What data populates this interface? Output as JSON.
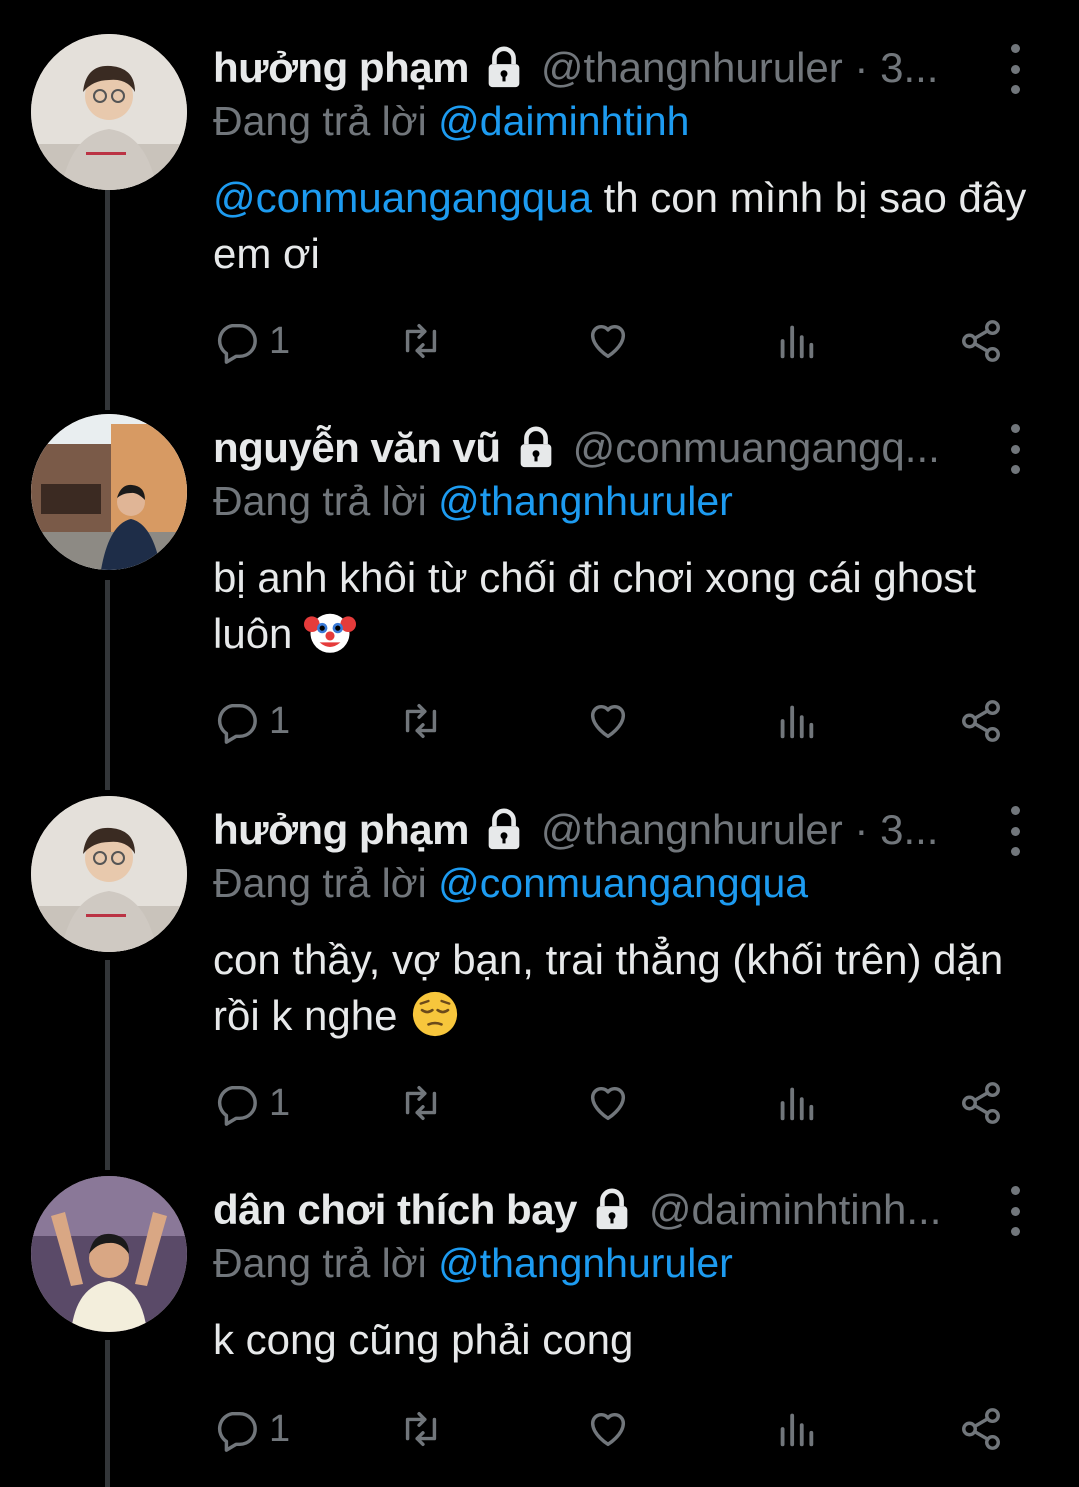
{
  "tweets": [
    {
      "name": "hưởng phạm",
      "handle": "@thangnhuruler · 3...",
      "replying_label": "Đang trả lời",
      "replying_to": "@daiminhtinh",
      "mention": "@conmuangangqua",
      "text": " th con mình bị sao đây em ơi",
      "reply_count": "1"
    },
    {
      "name": "nguyễn văn vũ",
      "handle": "@conmuangangq...",
      "replying_label": "Đang trả lời",
      "replying_to": "@thangnhuruler",
      "mention": "",
      "text": "bị anh khôi từ chối đi chơi xong cái ghost luôn",
      "emoji": "clown-face",
      "reply_count": "1"
    },
    {
      "name": "hưởng phạm",
      "handle": "@thangnhuruler · 3...",
      "replying_label": "Đang trả lời",
      "replying_to": "@conmuangangqua",
      "mention": "",
      "text": "con thầy, vợ bạn, trai thẳng (khối trên) dặn rồi k nghe",
      "emoji": "pensive-face",
      "reply_count": "1"
    },
    {
      "name": "dân chơi thích bay",
      "handle": "@daiminhtinh...",
      "replying_label": "Đang trả lời",
      "replying_to": "@thangnhuruler",
      "mention": "",
      "text": "k cong cũng phải cong",
      "reply_count": "1"
    }
  ],
  "colors": {
    "background": "#000000",
    "text": "#e7e9ea",
    "muted": "#71767b",
    "accent": "#1d9bf0"
  },
  "icons": [
    "lock-icon",
    "more-icon",
    "reply-icon",
    "retweet-icon",
    "like-icon",
    "views-icon",
    "share-icon"
  ]
}
